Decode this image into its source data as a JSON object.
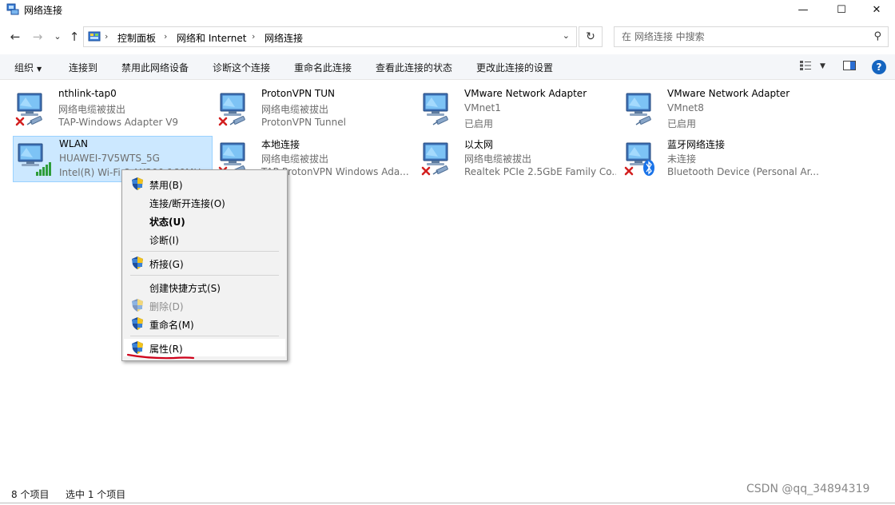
{
  "window": {
    "title": "网络连接",
    "minimize_glyph": "—",
    "maximize_glyph": "☐",
    "close_glyph": "✕"
  },
  "navigation": {
    "back_glyph": "←",
    "forward_glyph": "→",
    "recent_glyph": "⌄",
    "up_glyph": "↑",
    "breadcrumbs": [
      "控制面板",
      "网络和 Internet",
      "网络连接"
    ],
    "dropdown_glyph": "⌄",
    "refresh_glyph": "↻"
  },
  "search": {
    "placeholder": "在 网络连接 中搜索",
    "icon": "search-icon"
  },
  "commands": {
    "organize": "组织",
    "connect_to": "连接到",
    "disable_device": "禁用此网络设备",
    "diagnose": "诊断这个连接",
    "rename": "重命名此连接",
    "view_status": "查看此连接的状态",
    "change_settings": "更改此连接的设置",
    "help_glyph": "?"
  },
  "connections": [
    {
      "name": "nthlink-tap0",
      "status": "网络电缆被拔出",
      "device": "TAP-Windows Adapter V9",
      "state": "disconnected",
      "selected": false
    },
    {
      "name": "ProtonVPN TUN",
      "status": "网络电缆被拔出",
      "device": "ProtonVPN Tunnel",
      "state": "disconnected",
      "selected": false
    },
    {
      "name": "VMware Network Adapter",
      "status": "VMnet1",
      "device": "已启用",
      "state": "enabled",
      "selected": false
    },
    {
      "name": "VMware Network Adapter",
      "status": "VMnet8",
      "device": "已启用",
      "state": "enabled",
      "selected": false
    },
    {
      "name": "WLAN",
      "status": "HUAWEI-7V5WTS_5G",
      "device": "Intel(R) Wi-Fi 6 AX200 160MHz",
      "state": "wifi",
      "selected": true
    },
    {
      "name": "本地连接",
      "status": "网络电缆被拔出",
      "device": "TAP-ProtonVPN Windows Ada...",
      "state": "disconnected",
      "selected": false
    },
    {
      "name": "以太网",
      "status": "网络电缆被拔出",
      "device": "Realtek PCIe 2.5GbE Family Co...",
      "state": "disconnected",
      "selected": false
    },
    {
      "name": "蓝牙网络连接",
      "status": "未连接",
      "device": "Bluetooth Device (Personal Ar...",
      "state": "bluetooth",
      "selected": false
    }
  ],
  "context_menu": {
    "disable": "禁用(B)",
    "connect_disconnect": "连接/断开连接(O)",
    "status": "状态(U)",
    "diagnose": "诊断(I)",
    "bridge": "桥接(G)",
    "create_shortcut": "创建快捷方式(S)",
    "delete": "删除(D)",
    "rename": "重命名(M)",
    "properties": "属性(R)",
    "annotation_color": "#d0021b"
  },
  "statusbar": {
    "item_count": "8 个项目",
    "selected_count": "选中 1 个项目"
  },
  "watermark": "CSDN @qq_34894319"
}
